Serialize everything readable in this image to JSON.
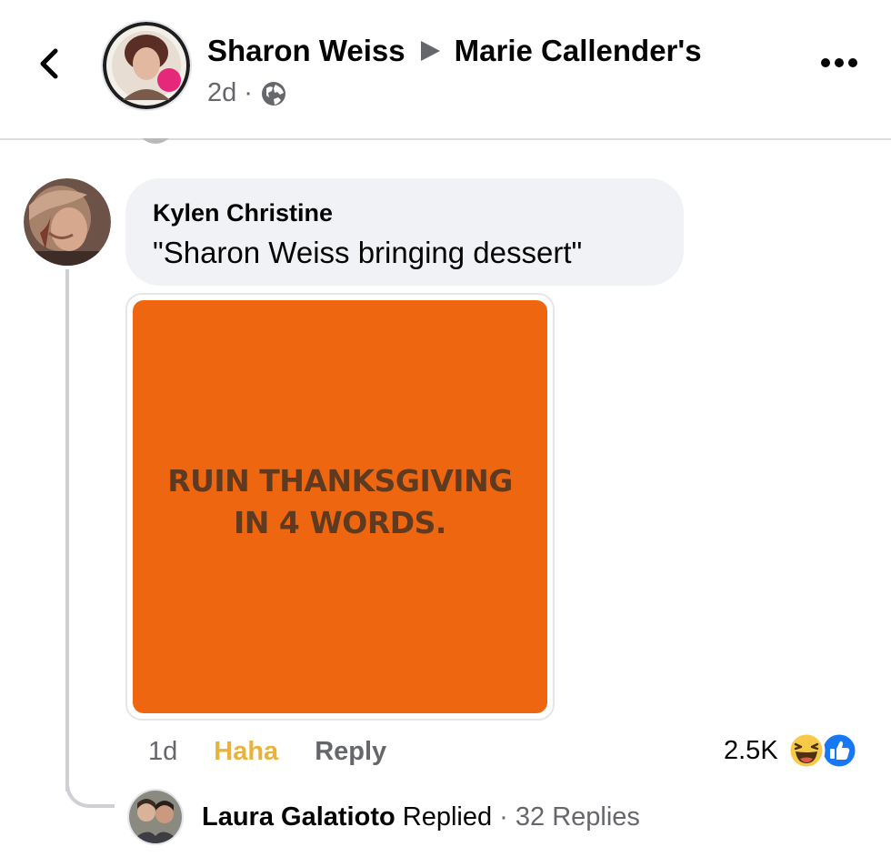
{
  "header": {
    "author": "Sharon Weiss",
    "target_page": "Marie Callender's",
    "time": "2d",
    "separator": "·",
    "icons": {
      "back": "chevron-left-icon",
      "audience": "globe-icon",
      "arrow": "triangle-right-icon",
      "more": "more-dots-icon"
    }
  },
  "comment": {
    "author": "Kylen Christine",
    "text": "\"Sharon Weiss bringing dessert\"",
    "image": {
      "line1": "RUIN THANKSGIVING",
      "line2": "IN 4 WORDS.",
      "background": "#ee6710",
      "text_color": "#5d3a20"
    },
    "actions": {
      "time": "1d",
      "reaction_label": "Haha",
      "reply_label": "Reply"
    },
    "reactions": {
      "count": "2.5K",
      "icons": [
        "haha-icon",
        "like-icon"
      ]
    }
  },
  "replies": {
    "replier": "Laura Galatioto",
    "replied_word": "Replied",
    "separator": "·",
    "count_label": "32 Replies"
  },
  "colors": {
    "haha": "#e8b23b",
    "secondary_text": "#65676b",
    "bubble": "#f0f2f5",
    "like_blue": "#1877f2"
  }
}
